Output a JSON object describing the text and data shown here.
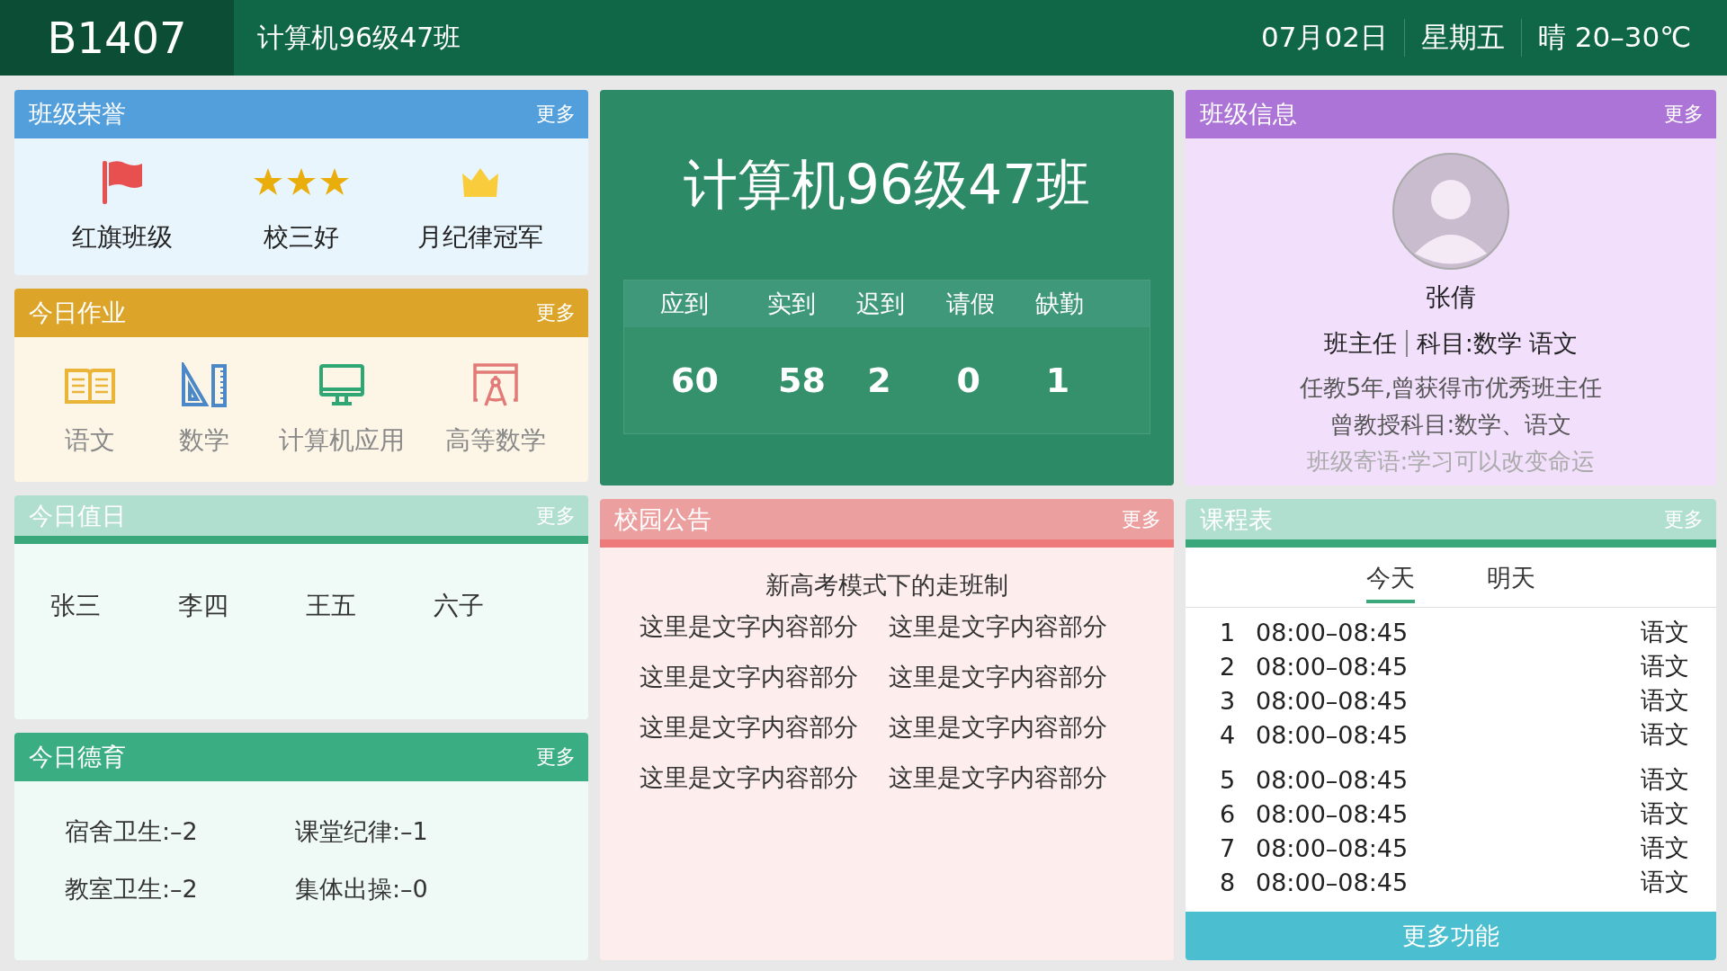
{
  "header": {
    "room": "B1407",
    "class_name": "计算机96级47班",
    "date": "07月02日",
    "weekday": "星期五",
    "weather": "晴 20–30℃"
  },
  "honors": {
    "title": "班级荣誉",
    "more": "更多",
    "items": [
      {
        "kind": "flag",
        "label": "红旗班级"
      },
      {
        "kind": "stars",
        "label": "校三好"
      },
      {
        "kind": "crown",
        "label": "月纪律冠军"
      }
    ]
  },
  "homework": {
    "title": "今日作业",
    "more": "更多",
    "items": [
      {
        "kind": "book",
        "label": "语文"
      },
      {
        "kind": "ruler",
        "label": "数学"
      },
      {
        "kind": "monitor",
        "label": "计算机应用"
      },
      {
        "kind": "compass",
        "label": "高等数学"
      }
    ]
  },
  "duty": {
    "title": "今日值日",
    "more": "更多",
    "names": [
      "张三",
      "李四",
      "王五",
      "六子"
    ]
  },
  "moral": {
    "title": "今日德育",
    "more": "更多",
    "items": [
      "宿舍卫生:–2",
      "课堂纪律:–1",
      "教室卫生:–2",
      "集体出操:–0"
    ]
  },
  "class_card": {
    "name": "计算机96级47班",
    "attendance": [
      {
        "label": "应到",
        "value": "60"
      },
      {
        "label": "实到",
        "value": "58"
      },
      {
        "label": "迟到",
        "value": "2"
      },
      {
        "label": "请假",
        "value": "0"
      },
      {
        "label": "缺勤",
        "value": "1"
      }
    ]
  },
  "announcement": {
    "title": "校园公告",
    "more": "更多",
    "headline": "新高考模式下的走班制",
    "lines": [
      "这里是文字内容部分",
      "这里是文字内容部分",
      "这里是文字内容部分",
      "这里是文字内容部分",
      "这里是文字内容部分",
      "这里是文字内容部分",
      "这里是文字内容部分",
      "这里是文字内容部分"
    ]
  },
  "info": {
    "title": "班级信息",
    "more": "更多",
    "teacher": "张倩",
    "role": "班主任",
    "subjects": "科目:数学 语文",
    "bio": [
      "任教5年,曾获得市优秀班主任",
      "曾教授科目:数学、语文",
      "班级寄语:学习可以改变命运"
    ]
  },
  "schedule": {
    "title": "课程表",
    "more": "更多",
    "tabs": [
      {
        "label": "今天",
        "selected": true
      },
      {
        "label": "明天",
        "selected": false
      }
    ],
    "rows": [
      {
        "index": "1",
        "time": "08:00–08:45",
        "subject": "语文"
      },
      {
        "index": "2",
        "time": "08:00–08:45",
        "subject": "语文"
      },
      {
        "index": "3",
        "time": "08:00–08:45",
        "subject": "语文"
      },
      {
        "index": "4",
        "time": "08:00–08:45",
        "subject": "语文"
      },
      {
        "index": "5",
        "time": "08:00–08:45",
        "subject": "语文"
      },
      {
        "index": "6",
        "time": "08:00–08:45",
        "subject": "语文"
      },
      {
        "index": "7",
        "time": "08:00–08:45",
        "subject": "语文"
      },
      {
        "index": "8",
        "time": "08:00–08:45",
        "subject": "语文"
      }
    ],
    "footer": "更多功能"
  }
}
